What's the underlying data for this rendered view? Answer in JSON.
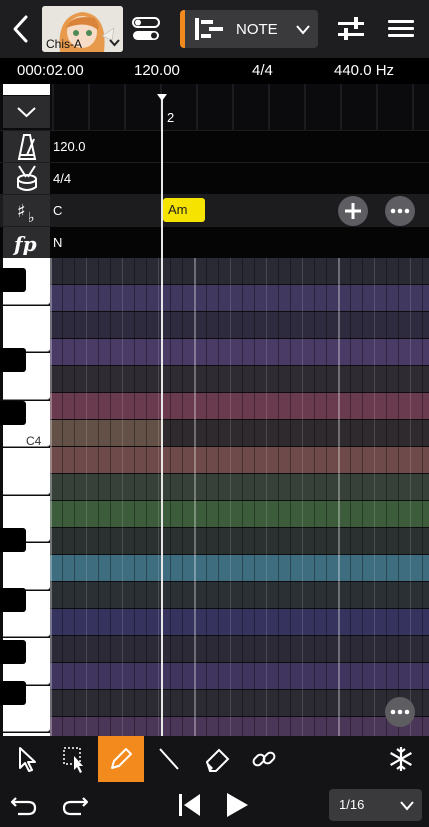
{
  "topbar": {
    "singer_name": "Chis-A",
    "mode_label": "NOTE",
    "accent_color": "#f28a1e"
  },
  "status": {
    "position": "000:02.00",
    "tempo": "120.00",
    "time_signature": "4/4",
    "pitch_reference": "440.0 Hz"
  },
  "ruler": {
    "measure_number": "2"
  },
  "tracks": {
    "tempo_value": "120.0",
    "meter_value": "4/4",
    "key_value": "C",
    "dynamics_value": "N",
    "chord_label": "Am"
  },
  "piano_roll": {
    "note_label": "C4"
  },
  "tools": {
    "icons": [
      "select-arrow-icon",
      "range-select-icon",
      "pencil-icon",
      "line-icon",
      "eraser-icon",
      "link-icon",
      "snowflake-icon"
    ],
    "active": "pencil-icon"
  },
  "transport": {
    "quantize_value": "1/16"
  }
}
